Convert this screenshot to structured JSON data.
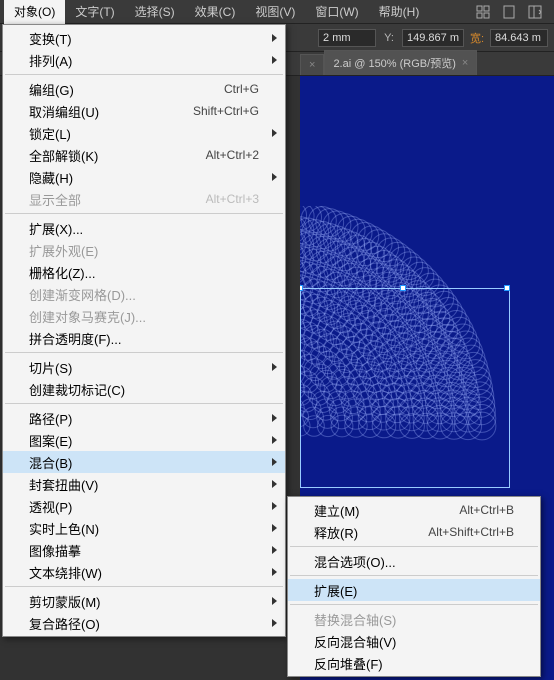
{
  "menubar": {
    "items": [
      {
        "label": "对象(O)",
        "active": true
      },
      {
        "label": "文字(T)"
      },
      {
        "label": "选择(S)"
      },
      {
        "label": "效果(C)"
      },
      {
        "label": "视图(V)"
      },
      {
        "label": "窗口(W)"
      },
      {
        "label": "帮助(H)"
      }
    ]
  },
  "toolbar": {
    "x_suffix": "2 mm",
    "y_label": "Y:",
    "y_value": "149.867 m",
    "w_label": "宽:",
    "w_value": "84.643 m"
  },
  "tabs": {
    "inactive_close": "×",
    "active": {
      "label": "2.ai @ 150% (RGB/预览)",
      "close": "×"
    }
  },
  "menu_object": [
    {
      "label": "变换(T)",
      "submenu": true
    },
    {
      "label": "排列(A)",
      "submenu": true
    },
    {
      "sep": true
    },
    {
      "label": "编组(G)",
      "shortcut": "Ctrl+G"
    },
    {
      "label": "取消编组(U)",
      "shortcut": "Shift+Ctrl+G"
    },
    {
      "label": "锁定(L)",
      "submenu": true
    },
    {
      "label": "全部解锁(K)",
      "shortcut": "Alt+Ctrl+2"
    },
    {
      "label": "隐藏(H)",
      "submenu": true
    },
    {
      "label": "显示全部",
      "shortcut": "Alt+Ctrl+3",
      "disabled": true
    },
    {
      "sep": true
    },
    {
      "label": "扩展(X)..."
    },
    {
      "label": "扩展外观(E)",
      "disabled": true
    },
    {
      "label": "栅格化(Z)..."
    },
    {
      "label": "创建渐变网格(D)...",
      "disabled": true
    },
    {
      "label": "创建对象马赛克(J)...",
      "disabled": true
    },
    {
      "label": "拼合透明度(F)..."
    },
    {
      "sep": true
    },
    {
      "label": "切片(S)",
      "submenu": true
    },
    {
      "label": "创建裁切标记(C)"
    },
    {
      "sep": true
    },
    {
      "label": "路径(P)",
      "submenu": true
    },
    {
      "label": "图案(E)",
      "submenu": true
    },
    {
      "label": "混合(B)",
      "submenu": true,
      "hover": true
    },
    {
      "label": "封套扭曲(V)",
      "submenu": true
    },
    {
      "label": "透视(P)",
      "submenu": true
    },
    {
      "label": "实时上色(N)",
      "submenu": true
    },
    {
      "label": "图像描摹",
      "submenu": true
    },
    {
      "label": "文本绕排(W)",
      "submenu": true
    },
    {
      "sep": true
    },
    {
      "label": "剪切蒙版(M)",
      "submenu": true
    },
    {
      "label": "复合路径(O)",
      "submenu": true
    }
  ],
  "menu_blend": [
    {
      "label": "建立(M)",
      "shortcut": "Alt+Ctrl+B"
    },
    {
      "label": "释放(R)",
      "shortcut": "Alt+Shift+Ctrl+B"
    },
    {
      "sep": true
    },
    {
      "label": "混合选项(O)..."
    },
    {
      "sep": true
    },
    {
      "label": "扩展(E)",
      "hover": true
    },
    {
      "sep": true
    },
    {
      "label": "替换混合轴(S)",
      "disabled": true
    },
    {
      "label": "反向混合轴(V)"
    },
    {
      "label": "反向堆叠(F)"
    }
  ]
}
